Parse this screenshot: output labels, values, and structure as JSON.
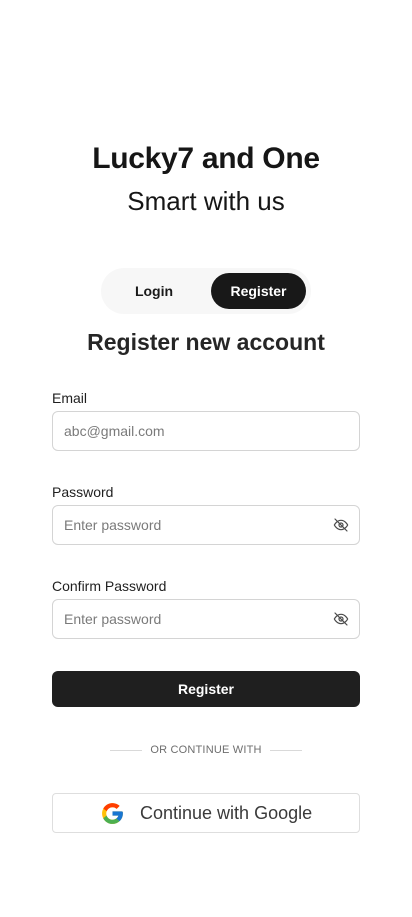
{
  "header": {
    "title": "Lucky7 and One",
    "subtitle": "Smart with us"
  },
  "tabs": {
    "login_label": "Login",
    "register_label": "Register",
    "active": "Register"
  },
  "form": {
    "heading": "Register new account",
    "email": {
      "label": "Email",
      "placeholder": "abc@gmail.com",
      "value": ""
    },
    "password": {
      "label": "Password",
      "placeholder": "Enter password",
      "value": "",
      "toggle_icon": "eye-off-icon"
    },
    "confirm_password": {
      "label": "Confirm Password",
      "placeholder": "Enter password",
      "value": "",
      "toggle_icon": "eye-off-icon"
    },
    "submit_label": "Register"
  },
  "social": {
    "divider_text": "OR CONTINUE WITH",
    "google_label": "Continue with Google",
    "google_icon": "google-logo-icon"
  },
  "colors": {
    "primary": "#1f1f1f",
    "tab_track": "#f7f7f7",
    "input_border": "#d4d4d4",
    "placeholder": "#7a7a7a"
  }
}
